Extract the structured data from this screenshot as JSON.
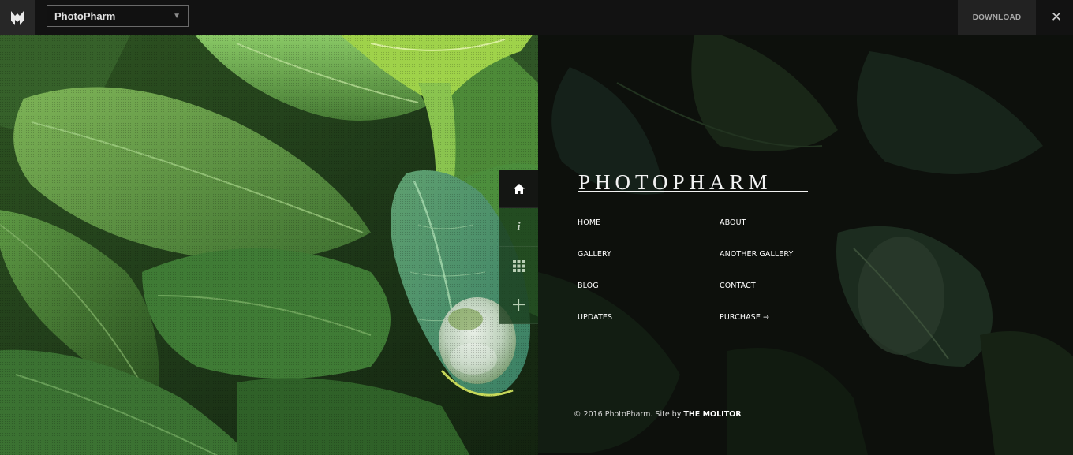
{
  "topbar": {
    "theme_name": "PhotoPharm",
    "download_label": "DOWNLOAD",
    "close_glyph": "✕",
    "select_caret": "▼"
  },
  "icons": {
    "logo": "molitor-logo-icon",
    "home": "home-icon",
    "info": "info-icon",
    "grid": "grid-icon",
    "plus": "plus-icon",
    "info_glyph": "i"
  },
  "site": {
    "title": "PHOTOPHARM",
    "menu": [
      {
        "label": "HOME"
      },
      {
        "label": "ABOUT"
      },
      {
        "label": "GALLERY"
      },
      {
        "label": "ANOTHER GALLERY"
      },
      {
        "label": "BLOG"
      },
      {
        "label": "CONTACT"
      },
      {
        "label": "UPDATES"
      },
      {
        "label": "PURCHASE →"
      }
    ],
    "footer_text": "© 2016 PhotoPharm. Site by",
    "footer_credit": "THE MOLITOR"
  },
  "colors": {
    "topbar_bg": "#121212",
    "leaf_green": "#5e9b3d",
    "dark_panel": "#0c0f0b",
    "nav_active": "#141613"
  }
}
